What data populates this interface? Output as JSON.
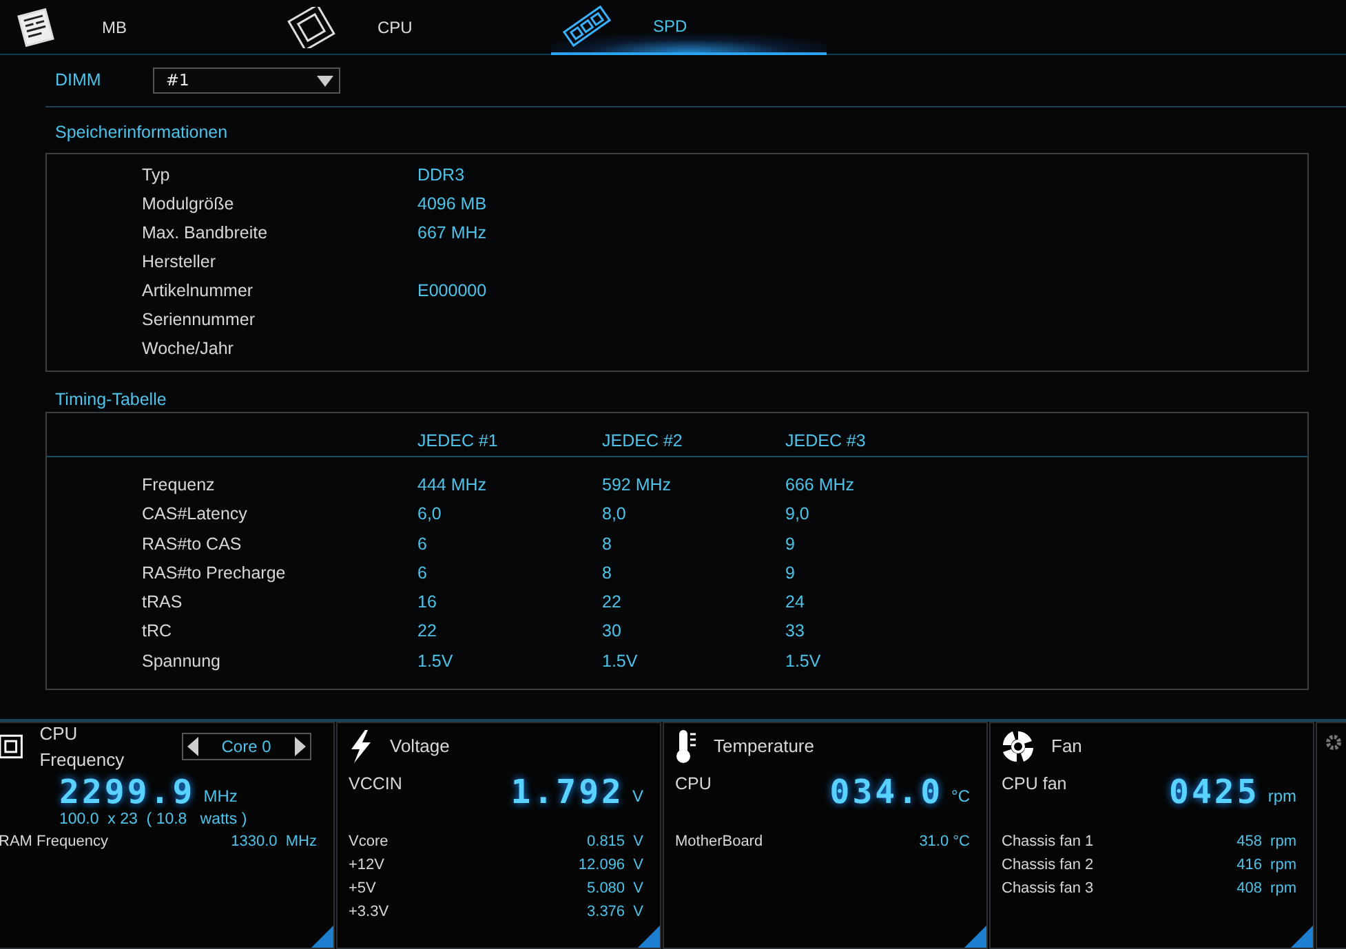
{
  "tabs": [
    {
      "kind": "board",
      "label": "MB",
      "selected": false
    },
    {
      "kind": "chip",
      "label": "CPU",
      "selected": false
    },
    {
      "kind": "memory",
      "label": "SPD",
      "selected": true
    }
  ],
  "dimm": {
    "label": "DIMM",
    "value": "#1"
  },
  "memory_info": {
    "title": "Speicherinformationen",
    "rows": [
      {
        "label": "Typ",
        "value": "DDR3"
      },
      {
        "label": "Modulgröße",
        "value": "4096 MB"
      },
      {
        "label": "Max. Bandbreite",
        "value": "667 MHz"
      },
      {
        "label": "Hersteller"
      },
      {
        "label": "Artikelnummer",
        "value": "E000000"
      },
      {
        "label": "Seriennummer"
      },
      {
        "label": "Woche/Jahr"
      }
    ]
  },
  "timing_table": {
    "title": "Timing-Tabelle",
    "columns": [
      "JEDEC #1",
      "JEDEC #2",
      "JEDEC #3"
    ],
    "rows": [
      {
        "label": "Frequenz",
        "values": [
          "444 MHz",
          "592 MHz",
          "666 MHz"
        ]
      },
      {
        "label": "CAS#Latency",
        "values": [
          "6,0",
          "8,0",
          "9,0"
        ]
      },
      {
        "label": "RAS#to CAS",
        "values": [
          "6",
          "8",
          "9"
        ]
      },
      {
        "label": "RAS#to Precharge",
        "values": [
          "6",
          "8",
          "9"
        ]
      },
      {
        "label": "tRAS",
        "values": [
          "16",
          "22",
          "24"
        ]
      },
      {
        "label": "tRC",
        "values": [
          "22",
          "30",
          "33"
        ]
      },
      {
        "label": "Spannung",
        "values": [
          "1.5V",
          "1.5V",
          "1.5V"
        ]
      }
    ]
  },
  "panels": [
    {
      "kind": "frequency",
      "title": "CPU Frequency",
      "selector": "Core 0",
      "main": {
        "value": "2299.9",
        "unit": "MHz"
      },
      "detail": "100.0  x 23  ( 10.8   watts )",
      "rows": [
        {
          "label": "RAM Frequency",
          "value": "1330.0  MHz"
        }
      ]
    },
    {
      "kind": "voltage",
      "title": "Voltage",
      "main": {
        "label": "VCCIN",
        "value": "1.792",
        "unit": "V"
      },
      "rows": [
        {
          "label": "Vcore",
          "value": "0.815  V"
        },
        {
          "label": "+12V",
          "value": "12.096  V"
        },
        {
          "label": "+5V",
          "value": "5.080  V"
        },
        {
          "label": "+3.3V",
          "value": "3.376  V"
        }
      ]
    },
    {
      "kind": "temperature",
      "title": "Temperature",
      "main": {
        "label": "CPU",
        "value": "034.0",
        "unit": "°C"
      },
      "rows": [
        {
          "label": "MotherBoard",
          "value": "31.0 °C"
        }
      ]
    },
    {
      "kind": "fan",
      "title": "Fan",
      "main": {
        "label": "CPU fan",
        "value": "0425",
        "unit": "rpm"
      },
      "rows": [
        {
          "label": "Chassis fan 1",
          "value": "458  rpm"
        },
        {
          "label": "Chassis fan 2",
          "value": "416  rpm"
        },
        {
          "label": "Chassis fan 3",
          "value": "408  rpm"
        }
      ]
    }
  ]
}
